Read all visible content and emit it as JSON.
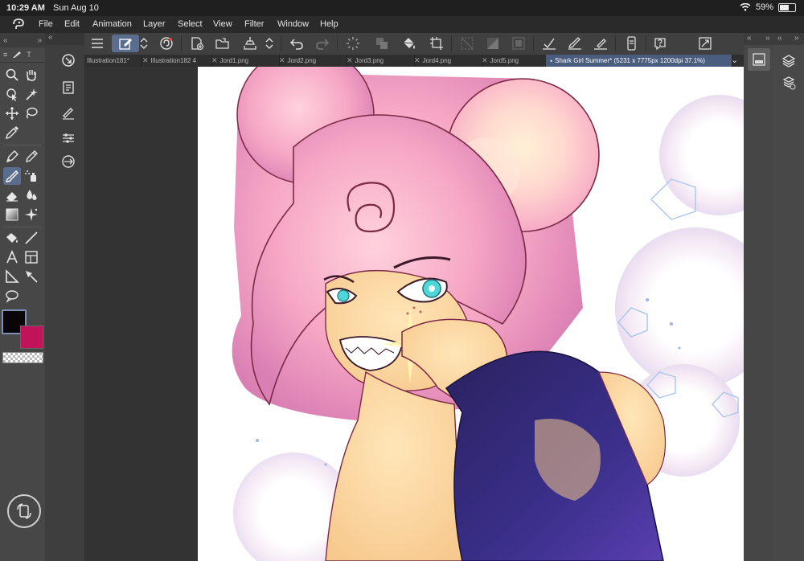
{
  "status": {
    "time": "10:29 AM",
    "date": "Sun Aug 10",
    "battery": "59%",
    "battery_level": 0.59
  },
  "menu": [
    "File",
    "Edit",
    "Animation",
    "Layer",
    "Select",
    "View",
    "Filter",
    "Window",
    "Help"
  ],
  "left_panel": {
    "collapse_left": "«",
    "collapse_right": "»",
    "tab_label": "T"
  },
  "tools": [
    "zoom-tool",
    "hand-tool",
    "object-select-tool",
    "auto-select-tool",
    "move-tool",
    "lasso-tool",
    "eyedropper-tool",
    "pen-tool",
    "pencil-tool",
    "brush-tool",
    "airbrush-tool",
    "eraser-tool",
    "blend-tool",
    "gradient-tool",
    "decoration-tool",
    "fill-tool",
    "line-tool",
    "text-tool",
    "frame-tool",
    "ruler-tool",
    "correct-line-tool",
    "balloon-tool"
  ],
  "colors": {
    "main": "#0a0508",
    "sub": "#c0135a",
    "accent": "#5b6d8e"
  },
  "tabs": [
    {
      "label": "Illustration181*",
      "closable": false
    },
    {
      "label": "Illustration182 4",
      "closable": true
    },
    {
      "label": "Jord1.png",
      "closable": true
    },
    {
      "label": "Jord2.png",
      "closable": true
    },
    {
      "label": "Jord3.png",
      "closable": true
    },
    {
      "label": "Jord4.png",
      "closable": true
    },
    {
      "label": "Jord5.png",
      "closable": true
    },
    {
      "label": "Shark Girl Summer* (5231 x 7775px 1200dpi 37.1%)",
      "closable": true,
      "active": true
    }
  ],
  "tab_overflow": "⌄"
}
